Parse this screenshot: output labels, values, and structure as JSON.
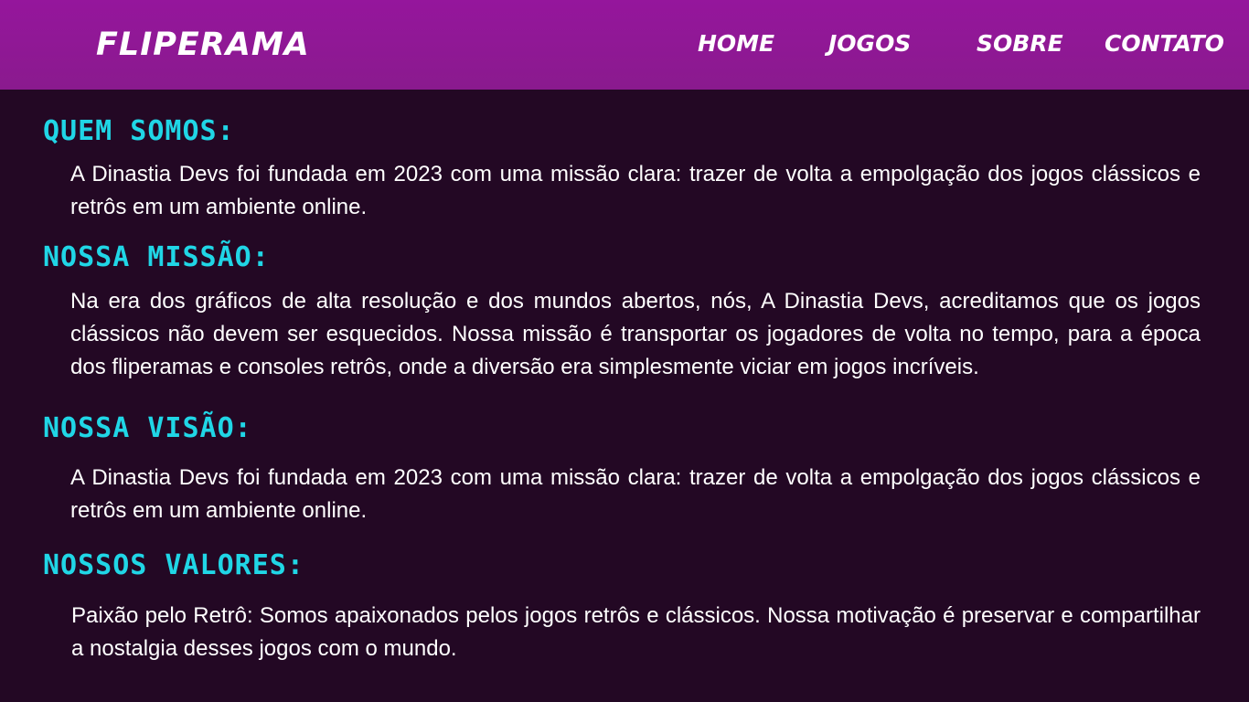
{
  "header": {
    "brand": "FLIPERAMA",
    "nav": {
      "home": "HOME",
      "jogos": "JOGOS",
      "sobre": "SOBRE",
      "contato": "CONTATO"
    }
  },
  "sections": [
    {
      "title": "QUEM SOMOS:",
      "text": "A Dinastia Devs foi fundada em 2023 com uma missão clara: trazer de volta a empolgação dos jogos clássicos e retrôs em um ambiente online."
    },
    {
      "title": "NOSSA MISSÃO:",
      "text": "Na era dos gráficos de alta resolução e dos mundos abertos, nós, A Dinastia Devs, acreditamos que os jogos clássicos não devem ser esquecidos. Nossa missão é transportar os jogadores de volta no tempo, para a época dos fliperamas e consoles retrôs, onde a diversão era simplesmente viciar em jogos incríveis."
    },
    {
      "title": "NOSSA VISÃO:",
      "text": "A Dinastia Devs foi fundada em 2023 com uma missão clara: trazer de volta a empolgação dos jogos clássicos e retrôs em um ambiente online."
    },
    {
      "title": "NOSSOS VALORES:",
      "text": "Paixão pelo Retrô: Somos apaixonados pelos jogos retrôs e clássicos. Nossa motivação é preservar e compartilhar a nostalgia desses jogos com o mundo."
    }
  ],
  "colors": {
    "header_bg": "#95169c",
    "page_bg": "#230824",
    "heading": "#20d6e6",
    "text": "#ffffff"
  }
}
